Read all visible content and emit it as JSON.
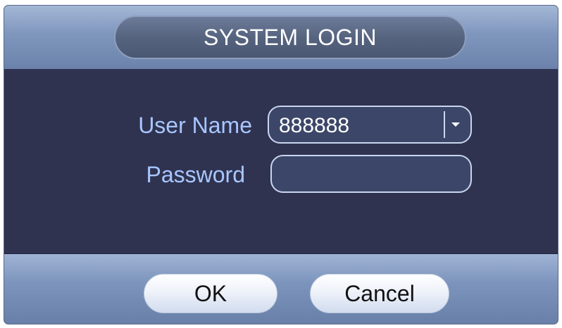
{
  "dialog": {
    "title": "SYSTEM LOGIN",
    "username": {
      "label": "User Name",
      "value": "888888",
      "dropdown_icon": "chevron-down-icon"
    },
    "password": {
      "label": "Password",
      "value": ""
    },
    "buttons": {
      "ok_label": "OK",
      "cancel_label": "Cancel"
    }
  },
  "colors": {
    "body_bg": "#2f3350",
    "label_text": "#a8c6ff",
    "title_text": "#ffffff",
    "header_gradient_top": "#a4b7d6",
    "footer_gradient_top": "#9fb3d4"
  }
}
